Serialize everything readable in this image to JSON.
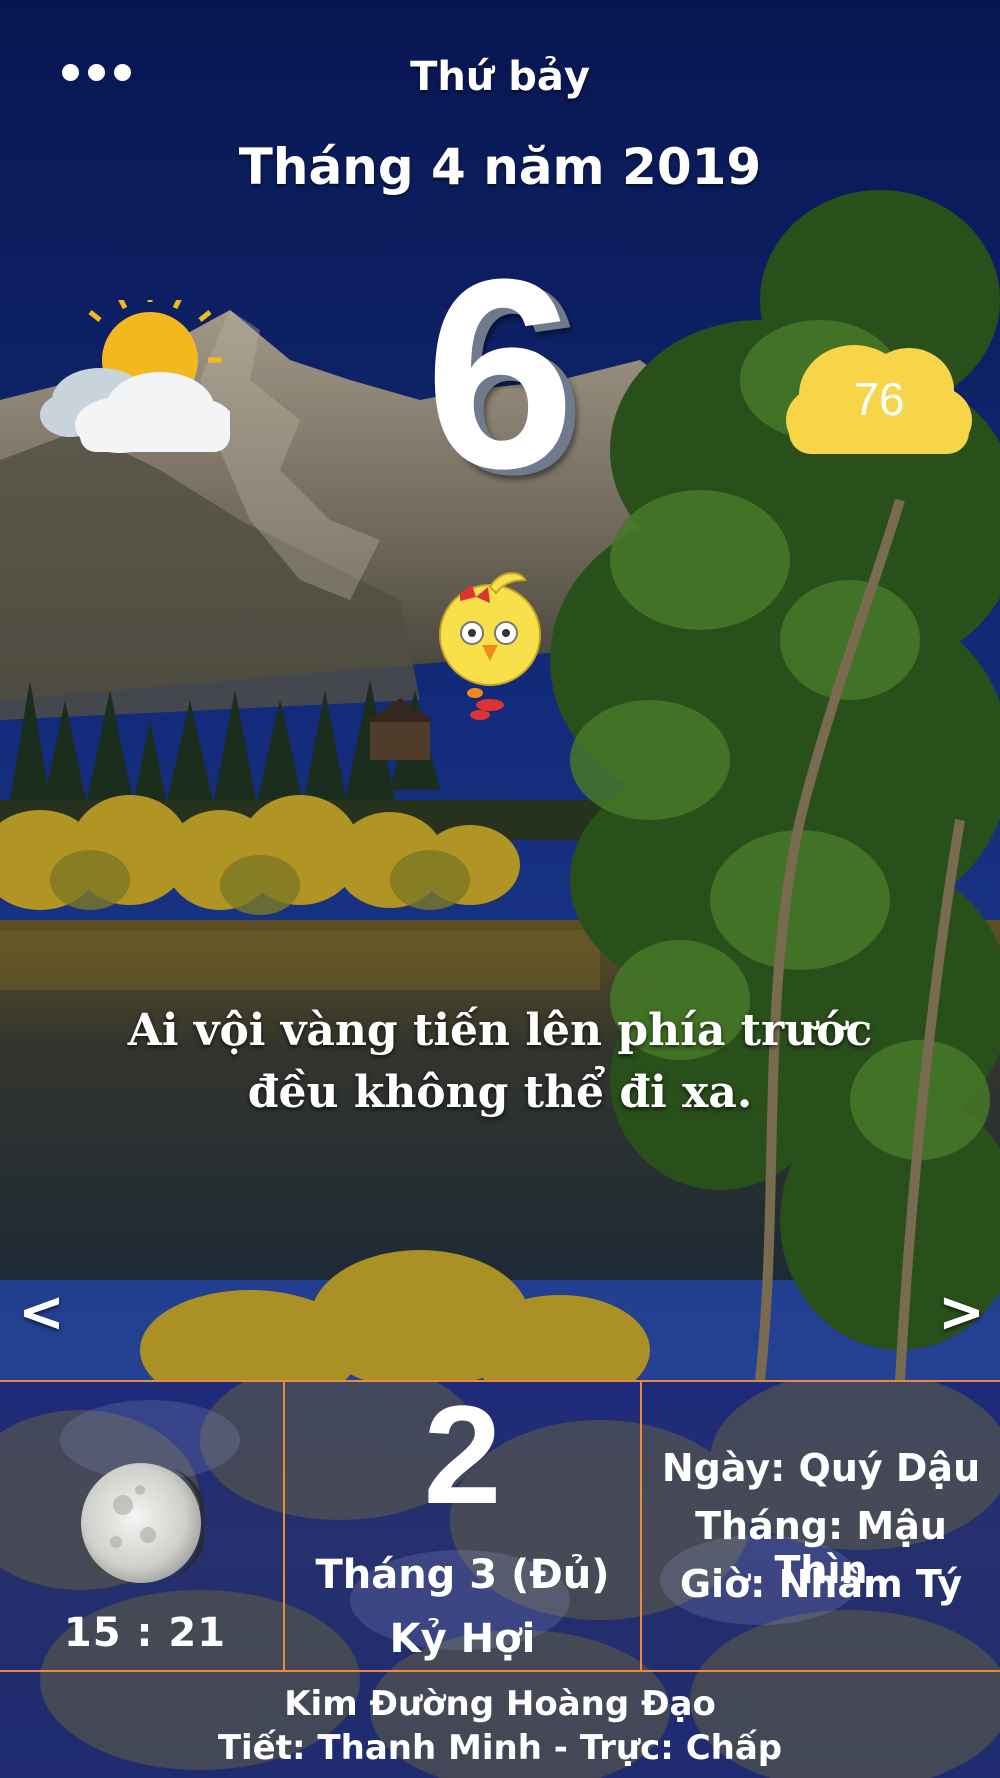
{
  "header": {
    "weekday": "Thứ bảy",
    "month_year": "Tháng 4 năm 2019"
  },
  "solar": {
    "day": "6"
  },
  "weather": {
    "icon": "sun-behind-cloud-icon",
    "aqi_value": "76",
    "aqi_color": "#f7d448"
  },
  "quote": {
    "line1": "Ai vội vàng tiến lên phía trước",
    "line2": "đều không thể đi xa."
  },
  "nav": {
    "prev": "<",
    "next": ">"
  },
  "lunar": {
    "moon_time": "15 : 21",
    "day": "2",
    "month": "Tháng 3 (Đủ)",
    "year": "Kỷ Hợi",
    "can_chi_day": "Ngày: Quý Dậu",
    "can_chi_month": "Tháng: Mậu Thìn",
    "can_chi_hour": "Giờ: Nhâm Tý"
  },
  "footer": {
    "line1": "Kim Đường Hoàng Đạo",
    "line2": "Tiết: Thanh Minh - Trực: Chấp"
  },
  "colors": {
    "divider": "#e98a3e",
    "panel": "#1f2b70"
  }
}
